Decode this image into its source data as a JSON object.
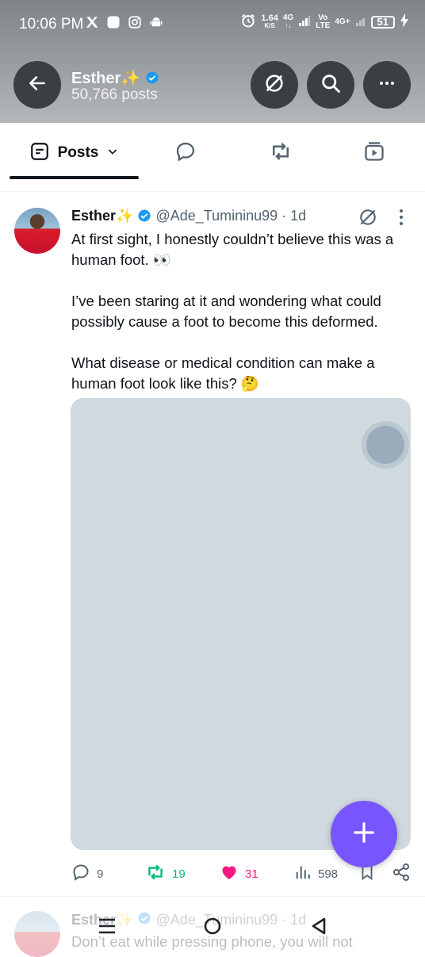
{
  "status_bar": {
    "time": "10:06 PM",
    "speed_value": "1.64",
    "speed_unit": "K/S",
    "net1": "4G",
    "net_volte_top": "Vo",
    "net_volte_bottom": "LTE",
    "net2": "4G+",
    "battery": "51",
    "icons": [
      "x-logo-icon",
      "app-icon",
      "instagram-icon",
      "android-icon",
      "alarm-icon",
      "signal-icon",
      "charging-icon"
    ]
  },
  "header": {
    "name": "Esther✨",
    "post_count": "50,766 posts",
    "buttons": [
      "back-arrow-icon",
      "grok-icon",
      "search-icon",
      "more-icon"
    ]
  },
  "tabs": {
    "posts_label": "Posts",
    "items": [
      "posts-tab",
      "replies-tab",
      "reposts-tab",
      "media-tab"
    ]
  },
  "tweet": {
    "name": "Esther✨",
    "handle": "@Ade_Tumininu99",
    "time": "· 1d",
    "paragraphs": [
      "At first sight, I honestly couldn’t believe this was a human foot. 👀",
      "I’ve been staring at it and wondering what could possibly cause a foot to become this deformed.",
      "What disease or medical condition can make a human foot look like this? 🤔"
    ],
    "replies": "9",
    "reposts": "19",
    "likes": "31",
    "views": "598"
  },
  "next_tweet": {
    "name": "Esther✨",
    "handle": "@Ade_Tumininu99",
    "time": "· 1d",
    "text": "Don’t eat while pressing phone, you will not"
  },
  "colors": {
    "accent": "#1d9bf0",
    "fab": "#7856ff",
    "repost_green": "#00ba7c",
    "like_pink": "#f91880"
  }
}
